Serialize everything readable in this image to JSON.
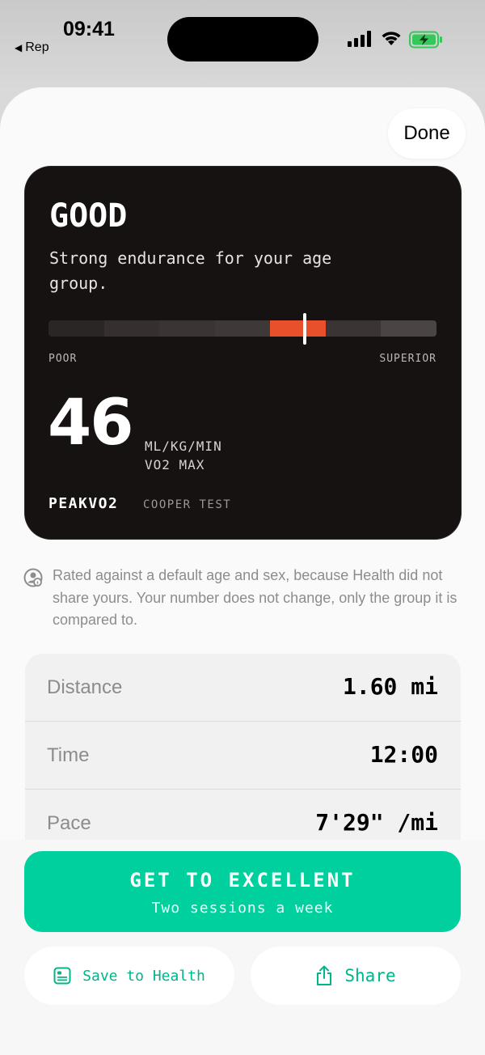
{
  "status_bar": {
    "time": "09:41",
    "back_label": "Rep",
    "battery_color": "#34c759"
  },
  "header": {
    "done_label": "Done"
  },
  "card": {
    "rating": "GOOD",
    "description": "Strong endurance for your age group.",
    "scale": {
      "low_label": "POOR",
      "high_label": "SUPERIOR",
      "segment_count": 7,
      "active_segment_index": 4,
      "marker_position": 0.66,
      "accent_color": "#e8502b"
    },
    "value": "46",
    "unit": "ML/KG/MIN",
    "metric": "VO2 MAX",
    "brand": "PEAKVO2",
    "method": "COOPER TEST"
  },
  "note": {
    "text": "Rated against a default age and sex, because Health did not share yours. Your number does not change, only the group it is compared to."
  },
  "stats": [
    {
      "label": "Distance",
      "value": "1.60 mi"
    },
    {
      "label": "Time",
      "value": "12:00"
    },
    {
      "label": "Pace",
      "value": "7'29\" /mi"
    }
  ],
  "cta": {
    "title": "GET TO EXCELLENT",
    "subtitle": "Two sessions a week",
    "color": "#00d09e"
  },
  "actions": {
    "save_label": "Save to Health",
    "share_label": "Share"
  }
}
